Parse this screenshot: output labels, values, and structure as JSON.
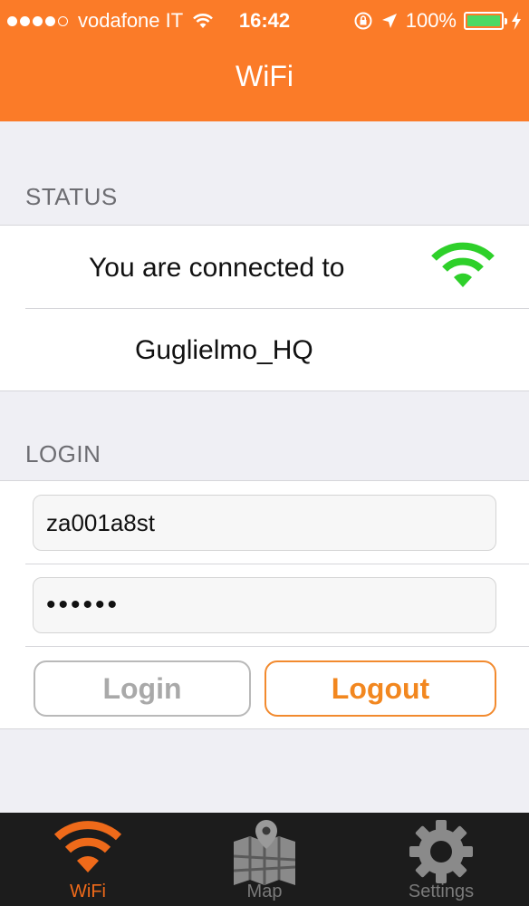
{
  "status_bar": {
    "carrier": "vodafone IT",
    "time": "16:42",
    "battery": "100%",
    "signal_bars_filled": 4,
    "signal_bars_total": 5
  },
  "nav": {
    "title": "WiFi"
  },
  "status_section": {
    "header": "STATUS",
    "connected_text": "You are connected to",
    "network_name": "Guglielmo_HQ"
  },
  "login_section": {
    "header": "LOGIN",
    "username_value": "za001a8st",
    "password_value": "••••••",
    "login_label": "Login",
    "logout_label": "Logout"
  },
  "tabs": [
    {
      "label": "WiFi",
      "icon": "wifi-icon",
      "active": true
    },
    {
      "label": "Map",
      "icon": "map-icon",
      "active": false
    },
    {
      "label": "Settings",
      "icon": "gear-icon",
      "active": false
    }
  ],
  "colors": {
    "accent": "#fb7b28",
    "connected": "#2ed02a",
    "tab_bar": "#1c1c1c",
    "battery": "#4cd964"
  }
}
